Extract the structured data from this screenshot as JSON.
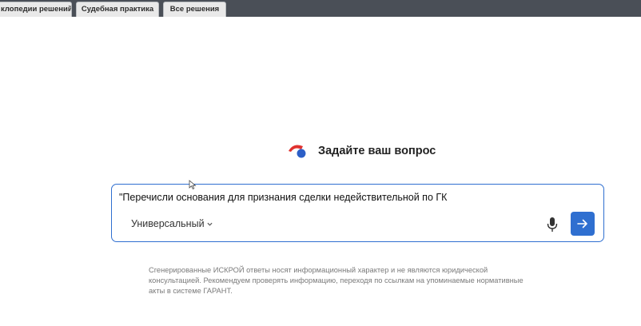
{
  "tabs": [
    {
      "label": "клопедии решений"
    },
    {
      "label": "Судебная практика"
    },
    {
      "label": "Все решения"
    }
  ],
  "prompt_title": "Задайте ваш вопрос",
  "query": {
    "value": "\"Перечисли основания для признания сделки недействительной по ГК"
  },
  "mode": {
    "selected": "Универсальный",
    "chevron_icon": "chevron-down-icon"
  },
  "icons": {
    "mic": "microphone-icon",
    "send": "arrow-right-icon",
    "logo": "iskra-logo"
  },
  "disclaimer": {
    "line1": "Сгенерированные ИСКРОЙ ответы носят информационный характер и не являются юридической",
    "line2": "консультацией. Рекомендуем проверять информацию, переходя по ссылкам на упоминаемые нормативные",
    "line3": "акты в системе ГАРАНТ."
  },
  "colors": {
    "accent": "#2f6fd0",
    "topbar": "#4a4f57",
    "logo_red": "#e0322f",
    "logo_blue": "#2c5fc7"
  }
}
